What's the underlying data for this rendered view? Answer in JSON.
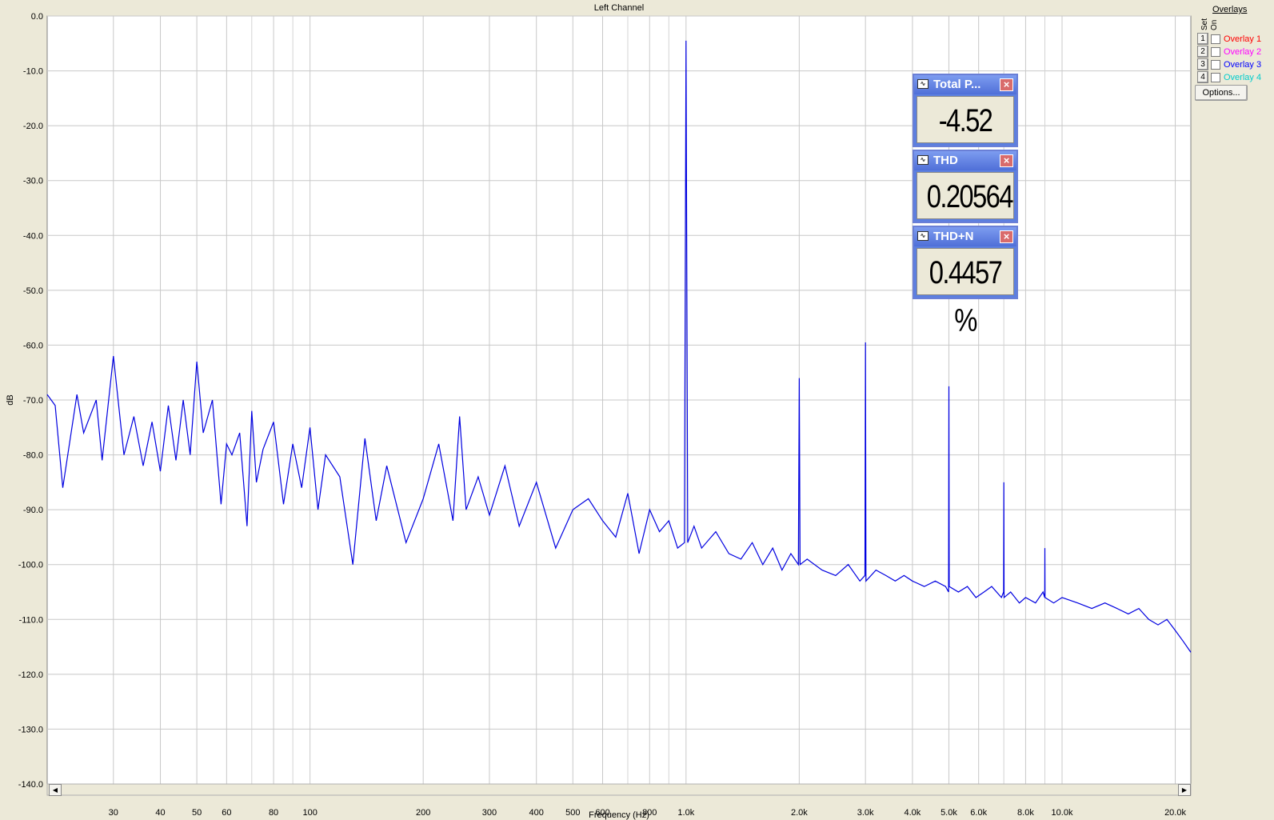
{
  "window": {
    "title": "Left Channel"
  },
  "chart_data": {
    "type": "line",
    "title": "Left Channel",
    "xlabel": "Frequency (Hz)",
    "ylabel": "dB",
    "xscale": "log",
    "xlim": [
      20,
      22000
    ],
    "ylim": [
      -140,
      0
    ],
    "grid": true,
    "y_ticks": [
      "0.0",
      "-10.0",
      "-20.0",
      "-30.0",
      "-40.0",
      "-50.0",
      "-60.0",
      "-70.0",
      "-80.0",
      "-90.0",
      "-100.0",
      "-110.0",
      "-120.0",
      "-130.0",
      "-140.0"
    ],
    "y_tick_values": [
      0,
      -10,
      -20,
      -30,
      -40,
      -50,
      -60,
      -70,
      -80,
      -90,
      -100,
      -110,
      -120,
      -130,
      -140
    ],
    "x_ticks": [
      {
        "value": 30,
        "label": "30"
      },
      {
        "value": 40,
        "label": "40"
      },
      {
        "value": 50,
        "label": "50"
      },
      {
        "value": 60,
        "label": "60"
      },
      {
        "value": 80,
        "label": "80"
      },
      {
        "value": 100,
        "label": "100"
      },
      {
        "value": 200,
        "label": "200"
      },
      {
        "value": 300,
        "label": "300"
      },
      {
        "value": 400,
        "label": "400"
      },
      {
        "value": 500,
        "label": "500"
      },
      {
        "value": 600,
        "label": "600"
      },
      {
        "value": 800,
        "label": "800"
      },
      {
        "value": 1000,
        "label": "1.0k"
      },
      {
        "value": 2000,
        "label": "2.0k"
      },
      {
        "value": 3000,
        "label": "3.0k"
      },
      {
        "value": 4000,
        "label": "4.0k"
      },
      {
        "value": 5000,
        "label": "5.0k"
      },
      {
        "value": 6000,
        "label": "6.0k"
      },
      {
        "value": 8000,
        "label": "8.0k"
      },
      {
        "value": 10000,
        "label": "10.0k"
      },
      {
        "value": 20000,
        "label": "20.0k"
      }
    ],
    "minor_grid": [
      70,
      90,
      700,
      900,
      7000,
      9000
    ],
    "series": [
      {
        "color": "#0000e0",
        "x": [
          20,
          21,
          22,
          24,
          25,
          27,
          28,
          30,
          32,
          34,
          36,
          38,
          40,
          42,
          44,
          46,
          48,
          50,
          52,
          55,
          58,
          60,
          62,
          65,
          68,
          70,
          72,
          75,
          80,
          85,
          90,
          95,
          100,
          105,
          110,
          120,
          130,
          140,
          150,
          160,
          180,
          200,
          220,
          240,
          250,
          260,
          280,
          300,
          330,
          360,
          400,
          450,
          500,
          550,
          600,
          650,
          700,
          750,
          800,
          850,
          900,
          950,
          990,
          1000,
          1010,
          1050,
          1100,
          1200,
          1300,
          1400,
          1500,
          1600,
          1700,
          1800,
          1900,
          1990,
          2000,
          2010,
          2100,
          2300,
          2500,
          2700,
          2900,
          2990,
          3000,
          3010,
          3200,
          3400,
          3600,
          3800,
          4000,
          4300,
          4600,
          4900,
          4990,
          5000,
          5010,
          5300,
          5600,
          5900,
          6200,
          6500,
          6900,
          6990,
          7000,
          7010,
          7300,
          7700,
          8000,
          8500,
          8900,
          8990,
          9000,
          9010,
          9500,
          10000,
          11000,
          12000,
          13000,
          14000,
          15000,
          16000,
          17000,
          18000,
          19000,
          20000,
          21000,
          22000
        ],
        "y": [
          -69,
          -71,
          -86,
          -69,
          -76,
          -70,
          -81,
          -62,
          -80,
          -73,
          -82,
          -74,
          -83,
          -71,
          -81,
          -70,
          -80,
          -63,
          -76,
          -70,
          -89,
          -78,
          -80,
          -76,
          -93,
          -72,
          -85,
          -79,
          -74,
          -89,
          -78,
          -86,
          -75,
          -90,
          -80,
          -84,
          -100,
          -77,
          -92,
          -82,
          -96,
          -88,
          -78,
          -92,
          -73,
          -90,
          -84,
          -91,
          -82,
          -93,
          -85,
          -97,
          -90,
          -88,
          -92,
          -95,
          -87,
          -98,
          -90,
          -94,
          -92,
          -97,
          -96,
          -4.5,
          -96,
          -93,
          -97,
          -94,
          -98,
          -99,
          -96,
          -100,
          -97,
          -101,
          -98,
          -100,
          -66,
          -100,
          -99,
          -101,
          -102,
          -100,
          -103,
          -102,
          -59.5,
          -103,
          -101,
          -102,
          -103,
          -102,
          -103,
          -104,
          -103,
          -104,
          -105,
          -67.5,
          -104,
          -105,
          -104,
          -106,
          -105,
          -104,
          -106,
          -105,
          -85,
          -106,
          -105,
          -107,
          -106,
          -107,
          -105,
          -106,
          -97,
          -106,
          -107,
          -106,
          -107,
          -108,
          -107,
          -108,
          -109,
          -108,
          -110,
          -111,
          -110,
          -112,
          -114,
          -116
        ]
      }
    ]
  },
  "overlays": {
    "title": "Overlays",
    "col_set": "Set",
    "col_on": "On",
    "items": [
      {
        "num": "1",
        "label": "Overlay 1",
        "color": "#ff0000"
      },
      {
        "num": "2",
        "label": "Overlay 2",
        "color": "#ff00ff"
      },
      {
        "num": "3",
        "label": "Overlay 3",
        "color": "#0000ff"
      },
      {
        "num": "4",
        "label": "Overlay 4",
        "color": "#00cccc"
      }
    ],
    "options_label": "Options..."
  },
  "meters": [
    {
      "title": "Total P...",
      "value": "-4.52 dB"
    },
    {
      "title": "THD",
      "value": "0.20564 %"
    },
    {
      "title": "THD+N",
      "value": "0.4457 %"
    }
  ]
}
